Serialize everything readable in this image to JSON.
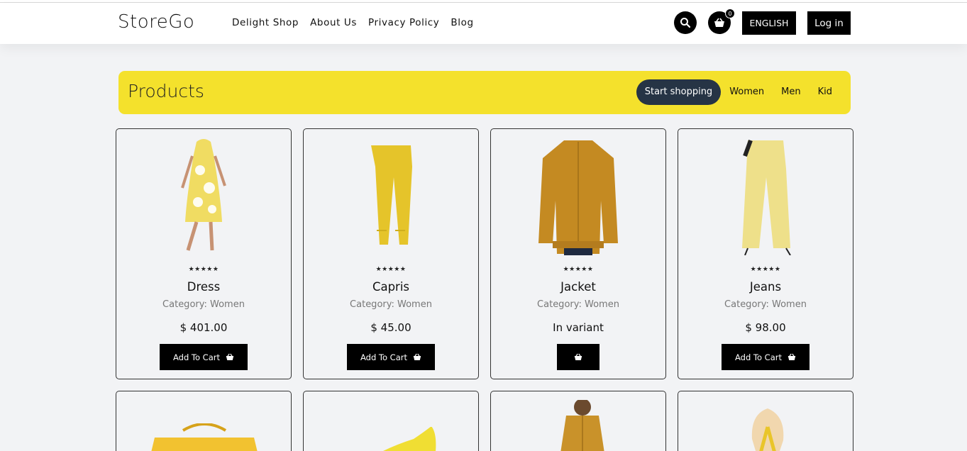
{
  "header": {
    "logo": "StoreGo",
    "nav": [
      "Delight Shop",
      "About Us",
      "Privacy Policy",
      "Blog"
    ],
    "cart_count": "0",
    "language": "ENGLISH",
    "login": "Log in"
  },
  "banner": {
    "title": "Products",
    "filters": [
      "Start shopping",
      "Women",
      "Men",
      "Kid"
    ],
    "active_filter": "Start shopping",
    "color": "#f4e12c"
  },
  "products": [
    {
      "name": "Dress",
      "category": "Category: Women",
      "price": "$ 401.00",
      "rating": "★★★★★",
      "button": "Add To Cart"
    },
    {
      "name": "Capris",
      "category": "Category: Women",
      "price": "$ 45.00",
      "rating": "★★★★★",
      "button": "Add To Cart"
    },
    {
      "name": "Jacket",
      "category": "Category: Women",
      "price": "In variant",
      "rating": "★★★★★",
      "button": ""
    },
    {
      "name": "Jeans",
      "category": "Category: Women",
      "price": "$ 98.00",
      "rating": "★★★★★",
      "button": "Add To Cart"
    }
  ],
  "icons": {
    "search": "search-icon",
    "cart": "basket-icon"
  }
}
